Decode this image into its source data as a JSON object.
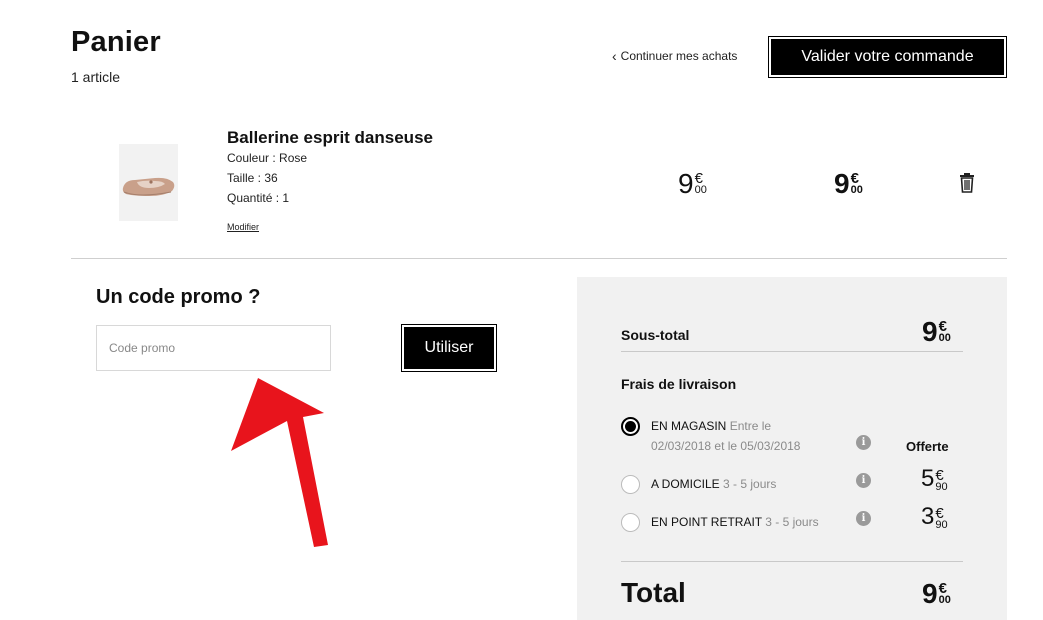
{
  "header": {
    "title": "Panier",
    "article_count": "1 article",
    "continue_label": "Continuer mes achats",
    "validate_label": "Valider votre commande"
  },
  "product": {
    "name": "Ballerine esprit danseuse",
    "color": "Couleur : Rose",
    "size": "Taille : 36",
    "quantity": "Quantité : 1",
    "modify_label": "Modifier",
    "unit_price": {
      "int": "9",
      "currency": "€",
      "cents": "00"
    },
    "total_price": {
      "int": "9",
      "currency": "€",
      "cents": "00"
    }
  },
  "promo": {
    "title": "Un code promo ?",
    "placeholder": "Code promo",
    "value": "",
    "button_label": "Utiliser"
  },
  "summary": {
    "subtotal_label": "Sous-total",
    "subtotal": {
      "int": "9",
      "currency": "€",
      "cents": "00"
    },
    "delivery_title": "Frais de livraison",
    "options": [
      {
        "label": "EN MAGASIN",
        "detail": "Entre le",
        "detail2": "02/03/2018 et le 05/03/2018",
        "selected": true,
        "price_text": "Offerte"
      },
      {
        "label": "A DOMICILE",
        "detail": "3 - 5 jours",
        "selected": false,
        "price": {
          "int": "5",
          "currency": "€",
          "cents": "90"
        }
      },
      {
        "label": "EN POINT RETRAIT",
        "detail": "3 - 5 jours",
        "selected": false,
        "price": {
          "int": "3",
          "currency": "€",
          "cents": "90"
        }
      }
    ],
    "total_label": "Total",
    "total": {
      "int": "9",
      "currency": "€",
      "cents": "00"
    }
  },
  "icons": {
    "trash": "trash-icon",
    "info": "info-icon",
    "chevron": "chevron-left-icon",
    "arrow": "red-arrow-annotation"
  },
  "colors": {
    "primary": "#000000",
    "panel_bg": "#f1f1f1",
    "annotation_arrow": "#e8141c"
  }
}
